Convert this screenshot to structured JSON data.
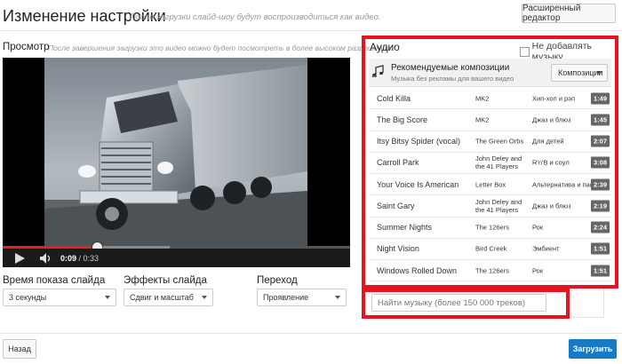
{
  "header": {
    "title": "Изменение настройки",
    "subtitle": "После загрузки слайд-шоу будут воспроизводиться как видео.",
    "advanced_button": "Расширенный редактор"
  },
  "preview": {
    "title": "Просмотр",
    "subtitle": "После завершения загрузки это видео можно будет посмотреть в более высоком разрешении.",
    "time_current": "0:09",
    "time_total": "/ 0:33",
    "played_fraction": 0.27,
    "buffered_fraction": 0.48
  },
  "settings": {
    "duration": {
      "label": "Время показа слайда",
      "value": "3 секунды"
    },
    "effects": {
      "label": "Эффекты слайда",
      "value": "Сдвиг и масштаб"
    },
    "transition": {
      "label": "Переход",
      "value": "Проявление"
    }
  },
  "audio": {
    "title": "Аудио",
    "no_music_label": "Не добавлять музыку",
    "recommended_title": "Рекомендуемые композиции",
    "recommended_subtitle": "Музыка без рекламы для вашего видео",
    "compositions_button": "Композиции",
    "tracks": [
      {
        "name": "Cold Killa",
        "artist": "MK2",
        "genre": "Хип-хоп и рэп",
        "duration": "1:49"
      },
      {
        "name": "The Big Score",
        "artist": "MK2",
        "genre": "Джаз и блюз",
        "duration": "1:45"
      },
      {
        "name": "Itsy Bitsy Spider (vocal)",
        "artist": "The Green Orbs",
        "genre": "Для детей",
        "duration": "2:07"
      },
      {
        "name": "Carroll Park",
        "artist": "John Deley and the 41 Players",
        "genre": "R'n'B и соул",
        "duration": "3:08"
      },
      {
        "name": "Your Voice Is American",
        "artist": "Letter Box",
        "genre": "Альтернатива и панк",
        "duration": "2:39"
      },
      {
        "name": "Saint Gary",
        "artist": "John Deley and the 41 Players",
        "genre": "Джаз и блюз",
        "duration": "2:19"
      },
      {
        "name": "Summer Nights",
        "artist": "The 126ers",
        "genre": "Рок",
        "duration": "2:24"
      },
      {
        "name": "Night Vision",
        "artist": "Bird Creek",
        "genre": "Эмбиент",
        "duration": "1:51"
      },
      {
        "name": "Windows Rolled Down",
        "artist": "The 126ers",
        "genre": "Рок",
        "duration": "1:51"
      }
    ],
    "search_placeholder": "Найти музыку (более 150 000 треков)"
  },
  "footer": {
    "back_button": "Назад",
    "upload_button": "Загрузить"
  },
  "colors": {
    "highlight": "#e8131f",
    "progress": "#e62117",
    "primary_button": "#167ac6"
  },
  "icons": [
    "play-icon",
    "volume-icon",
    "music-note-icon",
    "dropdown-caret-icon"
  ]
}
